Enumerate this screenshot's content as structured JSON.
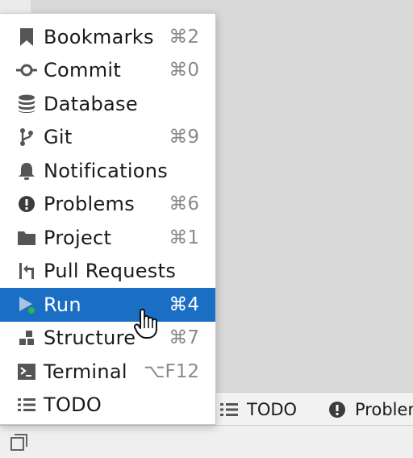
{
  "menu": {
    "items": [
      {
        "label": "Bookmarks",
        "shortcut": "⌘2",
        "icon": "bookmark-icon"
      },
      {
        "label": "Commit",
        "shortcut": "⌘0",
        "icon": "commit-icon"
      },
      {
        "label": "Database",
        "shortcut": "",
        "icon": "database-icon"
      },
      {
        "label": "Git",
        "shortcut": "⌘9",
        "icon": "git-branch-icon"
      },
      {
        "label": "Notifications",
        "shortcut": "",
        "icon": "bell-icon"
      },
      {
        "label": "Problems",
        "shortcut": "⌘6",
        "icon": "problems-icon"
      },
      {
        "label": "Project",
        "shortcut": "⌘1",
        "icon": "folder-icon"
      },
      {
        "label": "Pull Requests",
        "shortcut": "",
        "icon": "pull-request-icon"
      },
      {
        "label": "Run",
        "shortcut": "⌘4",
        "icon": "run-icon",
        "selected": true
      },
      {
        "label": "Structure",
        "shortcut": "⌘7",
        "icon": "structure-icon"
      },
      {
        "label": "Terminal",
        "shortcut": "⌥F12",
        "icon": "terminal-icon"
      },
      {
        "label": "TODO",
        "shortcut": "",
        "icon": "todo-list-icon"
      }
    ]
  },
  "toolwindow_strip": {
    "todo_label": "TODO",
    "problems_label": "Problen"
  },
  "colors": {
    "selection": "#1a6fc4",
    "shortcut": "#8a8a8a",
    "run_indicator": "#2fb34a"
  }
}
